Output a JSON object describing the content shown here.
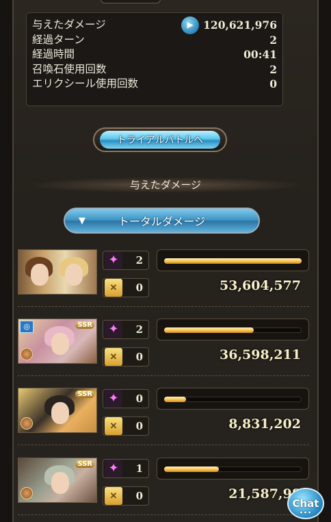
{
  "stats": [
    {
      "label": "与えたダメージ",
      "value": "120,621,976",
      "has_icon": true
    },
    {
      "label": "経過ターン",
      "value": "2"
    },
    {
      "label": "経過時間",
      "value": "00:41"
    },
    {
      "label": "召喚石使用回数",
      "value": "2"
    },
    {
      "label": "エリクシール使用回数",
      "value": "0"
    }
  ],
  "trial_button": "トライアルバトルへ",
  "section_title": "与えたダメージ",
  "dropdown": {
    "selected": "トータルダメージ",
    "icon": "triangle-down"
  },
  "members": [
    {
      "ougi": "2",
      "chain": "0",
      "damage": "53,604,577",
      "bar_pct": 100,
      "ssr": "",
      "ring": false
    },
    {
      "ougi": "2",
      "chain": "0",
      "damage": "36,598,211",
      "bar_pct": 65,
      "ssr": "SSR",
      "ring": true
    },
    {
      "ougi": "0",
      "chain": "0",
      "damage": "8,831,202",
      "bar_pct": 16,
      "ssr": "SSR",
      "ring": false
    },
    {
      "ougi": "1",
      "chain": "0",
      "damage": "21,587,98",
      "bar_pct": 40,
      "ssr": "SSR",
      "ring": false
    }
  ],
  "icons": {
    "ougi": "pink-sparkle-icon",
    "chain": "chain-burst-icon",
    "play": "play-icon"
  },
  "chat_label": "Chat",
  "colors": {
    "accent_blue": "#3e93c2",
    "bar_gold": "#f8c858",
    "damage_text": "#f6efc8"
  }
}
